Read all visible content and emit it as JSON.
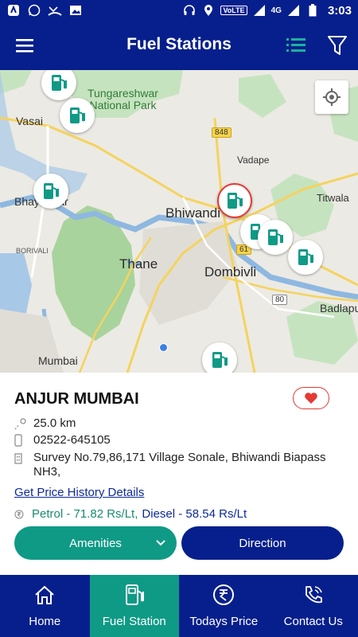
{
  "status_bar": {
    "network": "4G",
    "volte": "VoLTE",
    "time": "3:03"
  },
  "app_bar": {
    "title": "Fuel Stations"
  },
  "map": {
    "labels": {
      "park": "Tungareshwar\nNational Park",
      "vasai": "Vasai",
      "vadape": "Vadape",
      "titwala": "Titwala",
      "bhayandar": "Bhayandar",
      "bhiwandi": "Bhiwandi",
      "borivali": "BORIVALI",
      "thane": "Thane",
      "dombivli": "Dombivli",
      "badlapur": "Badlapu",
      "mumbai": "Mumbai"
    },
    "highways": {
      "h848": "848",
      "h61": "61",
      "h80": "80"
    }
  },
  "station": {
    "name": "ANJUR MUMBAI",
    "distance": "25.0 km",
    "phone": "02522-645105",
    "address": "Survey No.79,86,171 Village Sonale, Bhiwandi Biapass NH3,",
    "price_history_link": "Get Price History Details",
    "petrol": "Petrol - 71.82 Rs/Lt,",
    "diesel": "Diesel - 58.54 Rs/Lt",
    "amenities_label": "Amenities",
    "direction_label": "Direction"
  },
  "bottom_nav": [
    {
      "label": "Home",
      "icon": "home-icon"
    },
    {
      "label": "Fuel Station",
      "icon": "fuel-pump-icon"
    },
    {
      "label": "Todays Price",
      "icon": "rupee-icon"
    },
    {
      "label": "Contact Us",
      "icon": "phone-icon"
    }
  ],
  "colors": {
    "primary": "#061f8c",
    "accent": "#0f9a86",
    "favorite": "#e53935"
  }
}
